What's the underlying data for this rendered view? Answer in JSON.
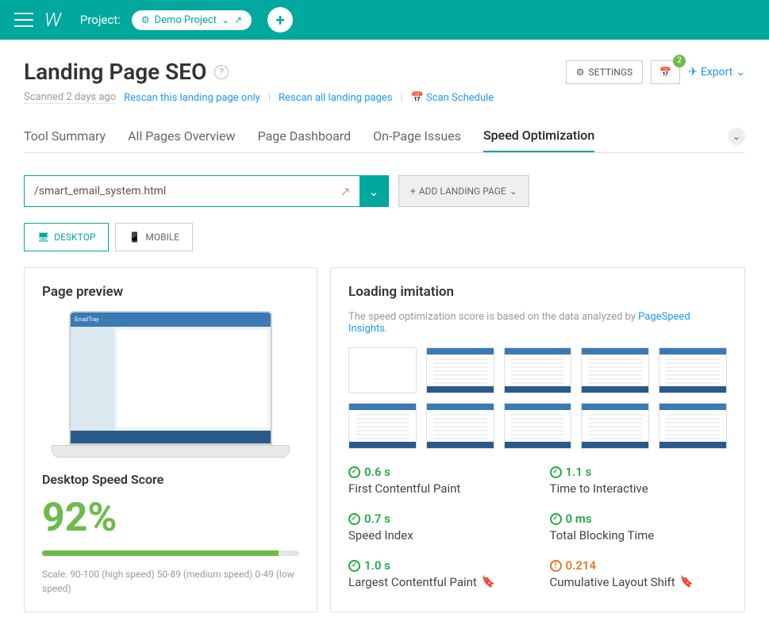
{
  "topbar": {
    "project_label": "Project:",
    "project_name": "Demo Project"
  },
  "page_title": "Landing Page SEO",
  "settings_label": "SETTINGS",
  "calendar_badge": "2",
  "export_label": "Export",
  "scanned_text": "Scanned 2 days ago",
  "rescan_this": "Rescan this landing page only",
  "rescan_all": "Rescan all landing pages",
  "scan_schedule": "Scan Schedule",
  "tabs": {
    "summary": "Tool Summary",
    "overview": "All Pages Overview",
    "dashboard": "Page Dashboard",
    "issues": "On-Page Issues",
    "speed": "Speed Optimization"
  },
  "url_value": "/smart_email_system.html",
  "add_landing_label": "ADD LANDING PAGE",
  "device": {
    "desktop": "DESKTOP",
    "mobile": "MOBILE"
  },
  "preview": {
    "title": "Page preview",
    "score_label": "Desktop Speed Score",
    "score_value": "92%",
    "score_percent": 92,
    "scale_text": "Scale: 90-100 (high speed) 50-89 (medium speed) 0-49 (low speed)"
  },
  "loading": {
    "title": "Loading imitation",
    "sub_prefix": "The speed optimization score is based on the data analyzed by ",
    "sub_link": "PageSpeed Insights",
    "sub_suffix": "."
  },
  "metrics": {
    "fcp": {
      "value": "0.6 s",
      "label": "First Contentful Paint",
      "status": "good"
    },
    "tti": {
      "value": "1.1 s",
      "label": "Time to Interactive",
      "status": "good"
    },
    "si": {
      "value": "0.7 s",
      "label": "Speed Index",
      "status": "good"
    },
    "tbt": {
      "value": "0 ms",
      "label": "Total Blocking Time",
      "status": "good"
    },
    "lcp": {
      "value": "1.0 s",
      "label": "Largest Contentful Paint",
      "status": "good",
      "bookmark": true
    },
    "cls": {
      "value": "0.214",
      "label": "Cumulative Layout Shift",
      "status": "warn",
      "bookmark": true
    }
  }
}
